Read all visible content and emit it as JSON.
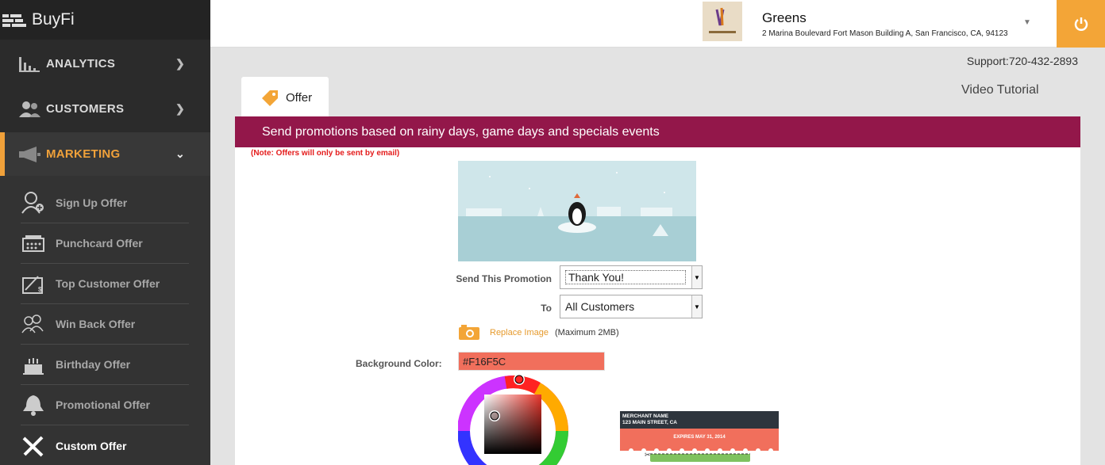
{
  "brand": {
    "name": "BuyFi"
  },
  "sidebar": {
    "menus": [
      {
        "label": "ANALYTICS",
        "icon": "bar-chart-icon"
      },
      {
        "label": "CUSTOMERS",
        "icon": "users-icon"
      },
      {
        "label": "MARKETING",
        "icon": "megaphone-icon"
      }
    ],
    "submenu": [
      {
        "label": "Sign Up Offer",
        "icon": "user-add-icon"
      },
      {
        "label": "Punchcard Offer",
        "icon": "punchcard-icon"
      },
      {
        "label": "Top Customer Offer",
        "icon": "certificate-icon"
      },
      {
        "label": "Win Back Offer",
        "icon": "group-icon"
      },
      {
        "label": "Birthday Offer",
        "icon": "cake-icon"
      },
      {
        "label": "Promotional Offer",
        "icon": "bell-icon"
      },
      {
        "label": "Custom Offer",
        "icon": "tools-icon"
      }
    ]
  },
  "merchant": {
    "name": "Greens",
    "address": "2 Marina Boulevard Fort Mason Building A, San Francisco, CA, 94123"
  },
  "support": "Support:720-432-2893",
  "tab": {
    "label": "Offer"
  },
  "video_tutorial": "Video Tutorial",
  "banner": "Send promotions based on rainy days, game days and specials events",
  "note": "(Note: Offers will only be sent by email)",
  "form": {
    "send_label": "Send This Promotion",
    "send_value": "Thank You!",
    "to_label": "To",
    "to_value": "All Customers",
    "replace_image": "Replace Image",
    "max_size": "(Maximum 2MB)",
    "bg_color_label": "Background Color:",
    "bg_color_value": "#F16F5C"
  },
  "card_preview": {
    "merchant": "MERCHANT NAME",
    "street": "123 MAIN STREET, CA",
    "expires": "EXPIRES MAY 31, 2014"
  },
  "colors": {
    "accent": "#f3a537",
    "banner": "#93174a",
    "selected_bg": "#f16f5c"
  }
}
